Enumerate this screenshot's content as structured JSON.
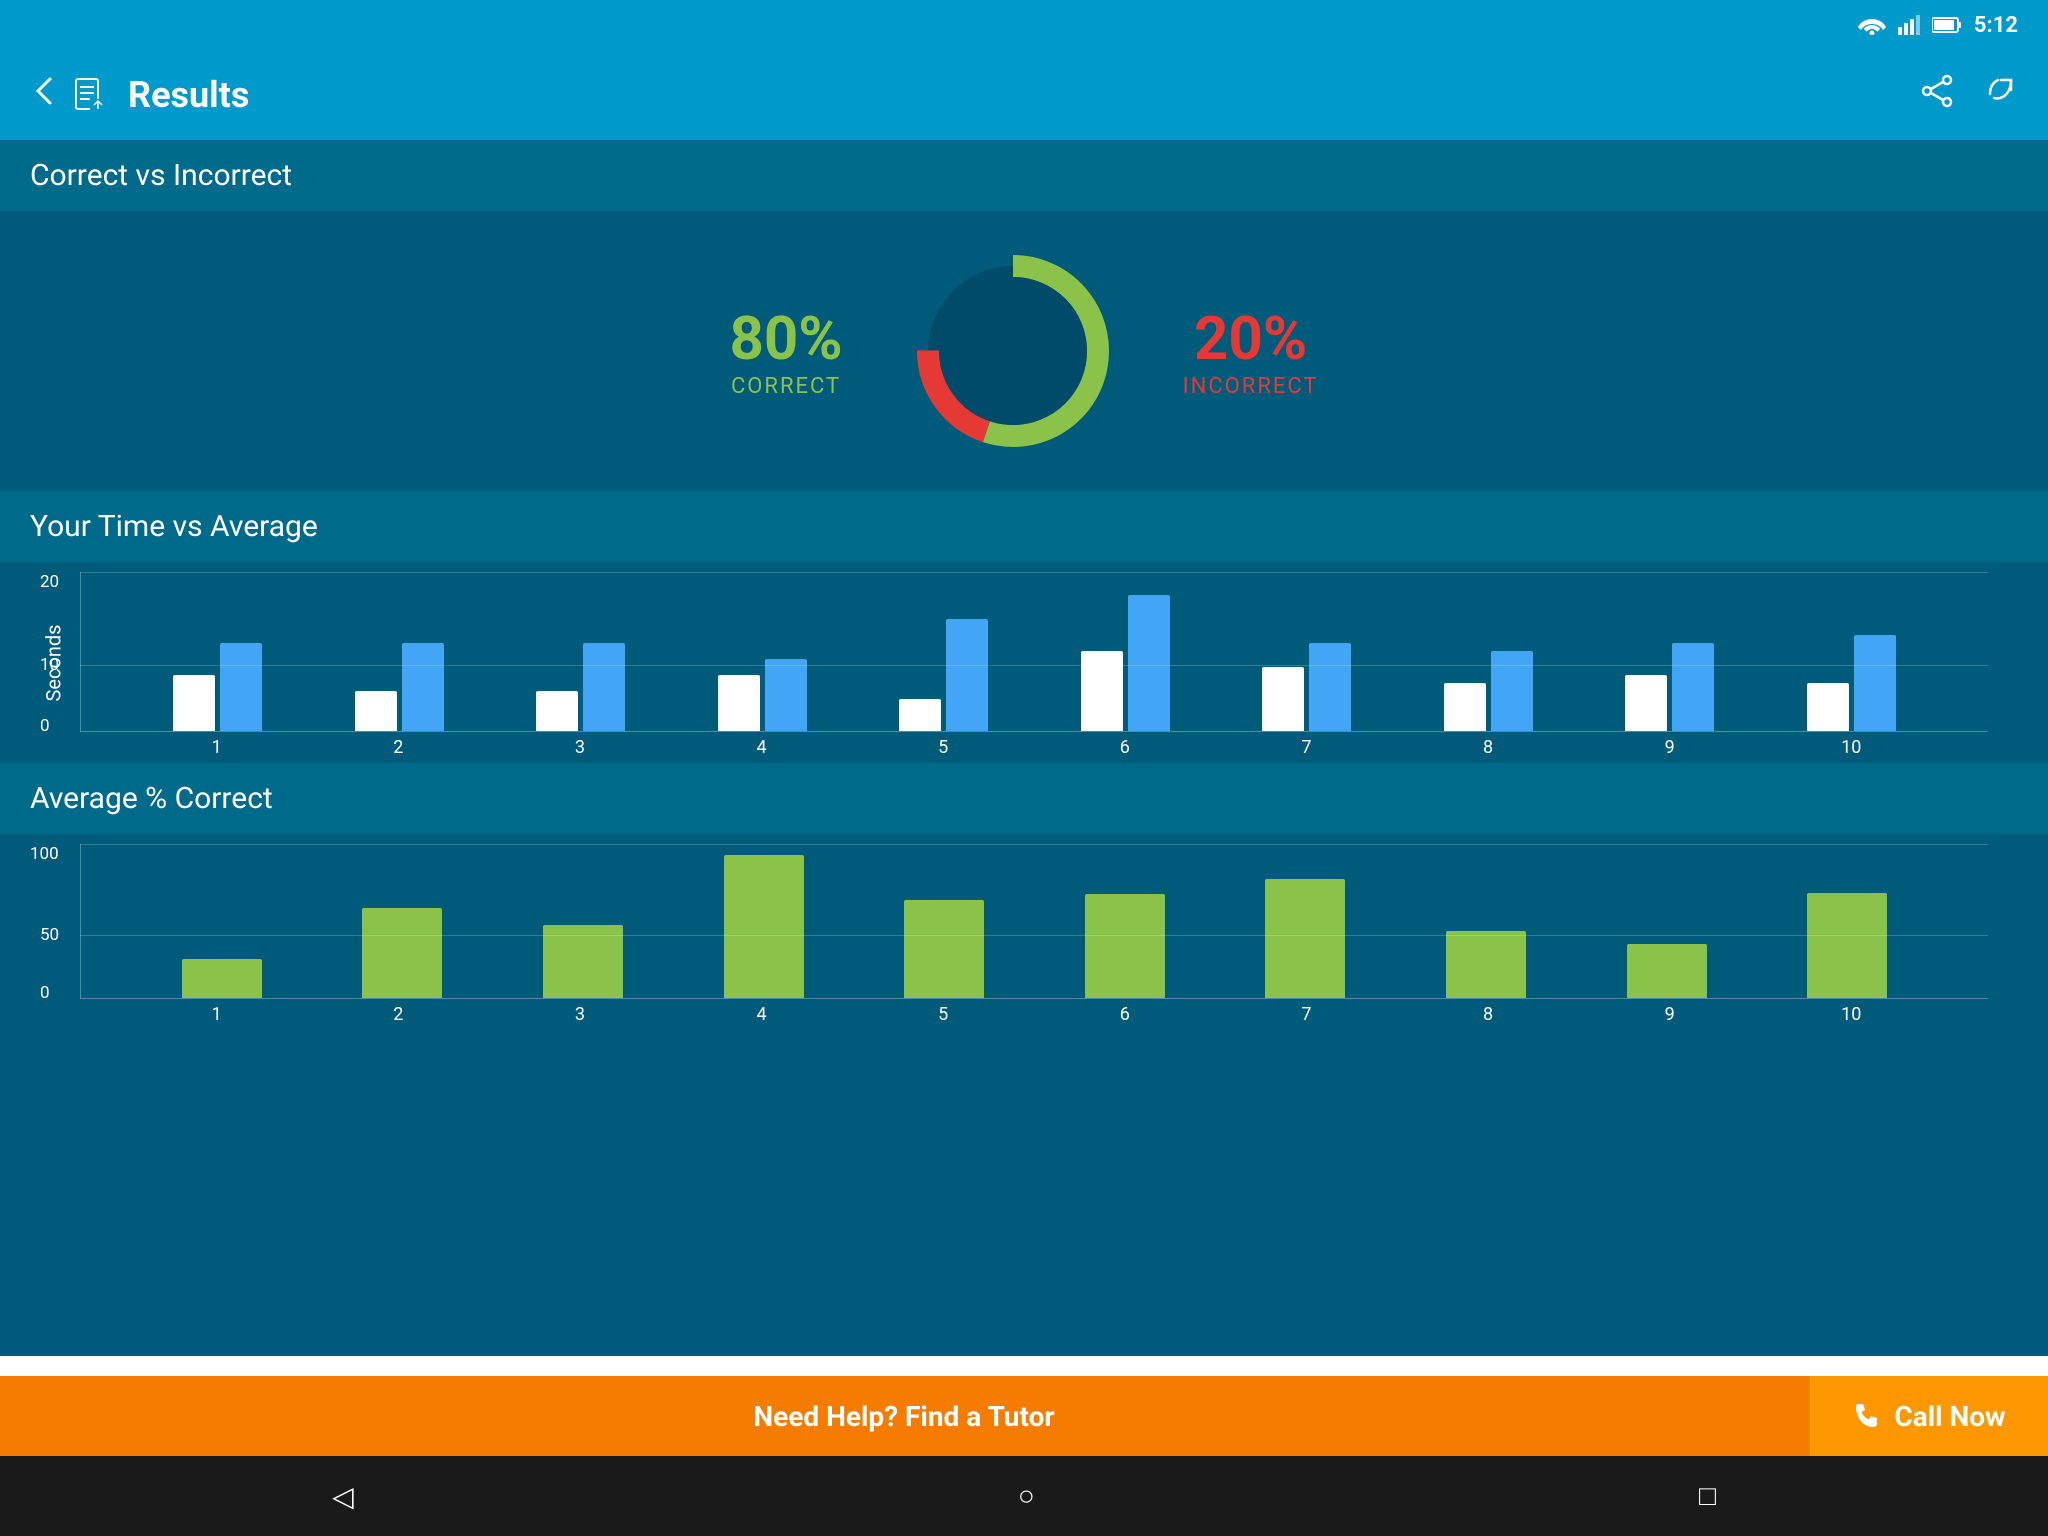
{
  "statusBar": {
    "time": "5:12"
  },
  "appBar": {
    "title": "Results",
    "backLabel": "←",
    "shareLabel": "share",
    "replayLabel": "replay"
  },
  "correctIncorrect": {
    "sectionTitle": "Correct vs Incorrect",
    "correctPct": "80%",
    "correctLabel": "CORRECT",
    "incorrectPct": "20%",
    "incorrectLabel": "INCORRECT",
    "correctValue": 80,
    "incorrectValue": 20
  },
  "timeChart": {
    "sectionTitle": "Your Time vs Average",
    "yAxisLabel": "Seconds",
    "yMax": 20,
    "yTicks": [
      0,
      10,
      20
    ],
    "bars": [
      {
        "x": 1,
        "your": 7,
        "avg": 11
      },
      {
        "x": 2,
        "your": 5,
        "avg": 11
      },
      {
        "x": 3,
        "your": 5,
        "avg": 11
      },
      {
        "x": 4,
        "your": 7,
        "avg": 9
      },
      {
        "x": 5,
        "your": 4,
        "avg": 14
      },
      {
        "x": 6,
        "your": 10,
        "avg": 17
      },
      {
        "x": 7,
        "your": 8,
        "avg": 11
      },
      {
        "x": 8,
        "your": 6,
        "avg": 10
      },
      {
        "x": 9,
        "your": 7,
        "avg": 11
      },
      {
        "x": 10,
        "your": 6,
        "avg": 12
      }
    ]
  },
  "avgCorrectChart": {
    "sectionTitle": "Average % Correct",
    "yMax": 100,
    "yTicks": [
      0,
      50,
      100
    ],
    "bars": [
      {
        "x": 1,
        "val": 25
      },
      {
        "x": 2,
        "val": 58
      },
      {
        "x": 3,
        "val": 47
      },
      {
        "x": 4,
        "val": 92
      },
      {
        "x": 5,
        "val": 63
      },
      {
        "x": 6,
        "val": 67
      },
      {
        "x": 7,
        "val": 77
      },
      {
        "x": 8,
        "val": 43
      },
      {
        "x": 9,
        "val": 35
      },
      {
        "x": 10,
        "val": 68
      }
    ]
  },
  "banner": {
    "helpText": "Need Help? Find a Tutor",
    "callNow": "Call Now"
  },
  "navBar": {
    "back": "◁",
    "home": "○",
    "recent": "□"
  },
  "colors": {
    "correct": "#8bc34a",
    "incorrect": "#e53935",
    "yourTime": "#ffffff",
    "avgTime": "#42a5f5",
    "avgCorrect": "#8bc34a",
    "appBarBg": "#0099cc",
    "sectionBg": "#005a7a",
    "sectionHeaderBg": "#006a8a"
  }
}
